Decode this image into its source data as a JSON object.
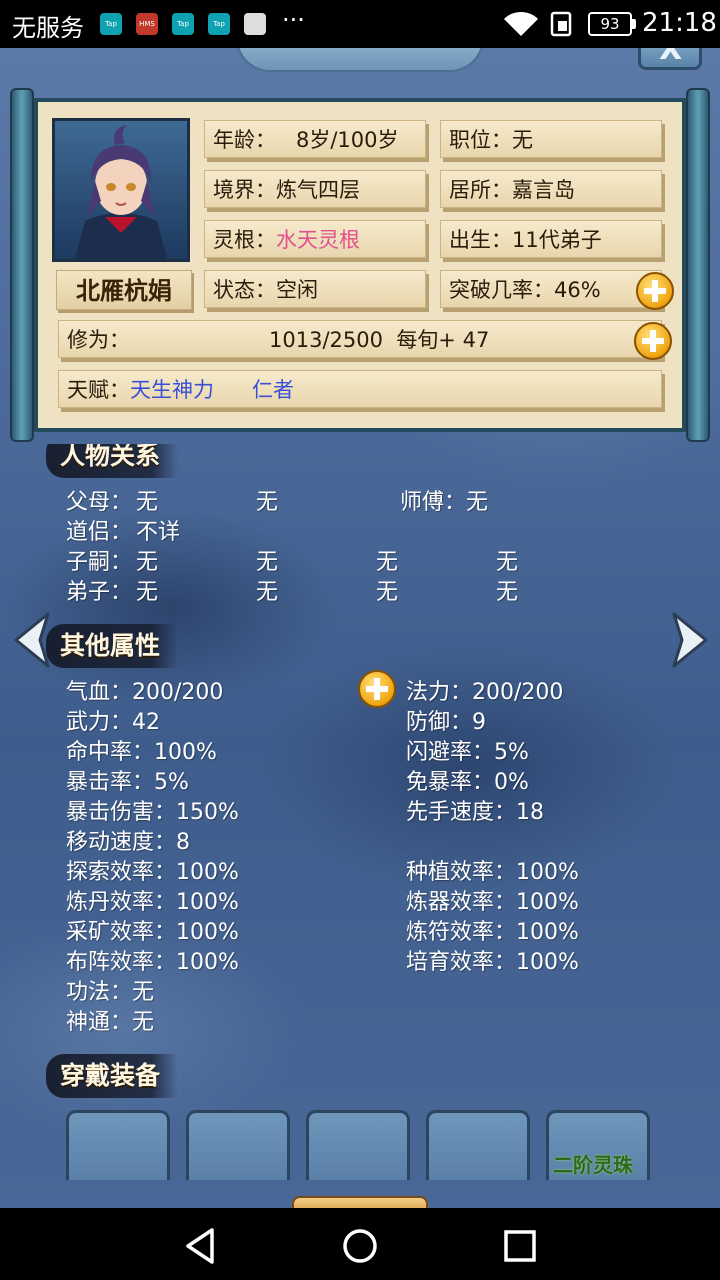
{
  "statusbar": {
    "carrier": "无服务",
    "apps": [
      "Tap",
      "HMS",
      "Tap",
      "Tap"
    ],
    "overflow": "···",
    "battery": "93",
    "time": "21:18"
  },
  "profile": {
    "name": "北雁杭娟",
    "age_label": "年龄：",
    "age_value": "8岁/100岁",
    "position": "职位：无",
    "realm": "境界：炼气四层",
    "residence": "居所：嘉言岛",
    "root_label": "灵根：",
    "root_value": "水天灵根",
    "birth": "出生：11代弟子",
    "status": "状态：空闲",
    "breakthrough": "突破几率：46%",
    "cultivation_label": "修为：",
    "cultivation_value": "1013/2500  每旬+ 47",
    "talent_label": "天赋：",
    "talents": [
      "天生神力",
      "仁者"
    ]
  },
  "relations": {
    "title": "人物关系",
    "rows": [
      {
        "label": "父母：",
        "values": [
          "无",
          "无"
        ],
        "extra": "师傅：无"
      },
      {
        "label": "道侣：",
        "values": [
          "不详"
        ]
      },
      {
        "label": "子嗣：",
        "values": [
          "无",
          "无",
          "无",
          "无"
        ]
      },
      {
        "label": "弟子：",
        "values": [
          "无",
          "无",
          "无",
          "无"
        ]
      }
    ]
  },
  "attributes": {
    "title": "其他属性",
    "left": [
      "气血：200/200",
      "武力：42",
      "命中率：100%",
      "暴击率：5%",
      "暴击伤害：150%",
      "移动速度：8",
      "探索效率：100%",
      "炼丹效率：100%",
      "采矿效率：100%",
      "布阵效率：100%",
      "功法：无",
      "神通：无"
    ],
    "right": [
      "法力：200/200",
      "防御：9",
      "闪避率：5%",
      "免暴率：0%",
      "先手速度：18",
      "",
      "种植效率：100%",
      "炼器效率：100%",
      "炼符效率：100%",
      "培育效率：100%"
    ]
  },
  "equipment": {
    "title": "穿戴装备",
    "slots": [
      "",
      "",
      "",
      "",
      "二阶灵珠"
    ]
  },
  "icons": {
    "close": "close-icon",
    "left_arrow": "arrow-left-icon",
    "right_arrow": "arrow-right-icon",
    "plus": "plus-icon"
  },
  "colors": {
    "pink_text": "#e1508f",
    "blue_text": "#3b4fd6",
    "slot_label": "#2b6a1c"
  }
}
